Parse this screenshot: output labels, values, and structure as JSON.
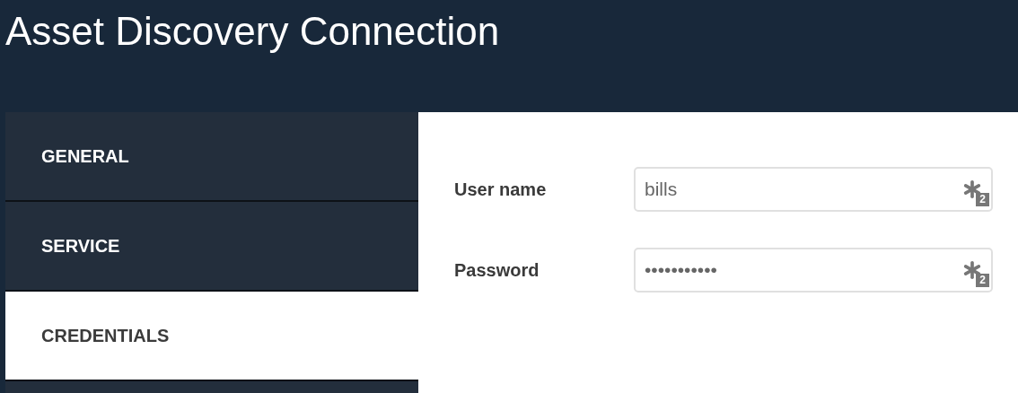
{
  "window": {
    "title": "Asset Discovery Connection"
  },
  "tabs": [
    {
      "label": "GENERAL",
      "selected": false
    },
    {
      "label": "SERVICE",
      "selected": false
    },
    {
      "label": "CREDENTIALS",
      "selected": true
    }
  ],
  "fields": [
    {
      "label": "User name",
      "value": "bills",
      "badge": "2"
    },
    {
      "label": "Password",
      "value": "•••••••••••",
      "badge": "2"
    }
  ]
}
